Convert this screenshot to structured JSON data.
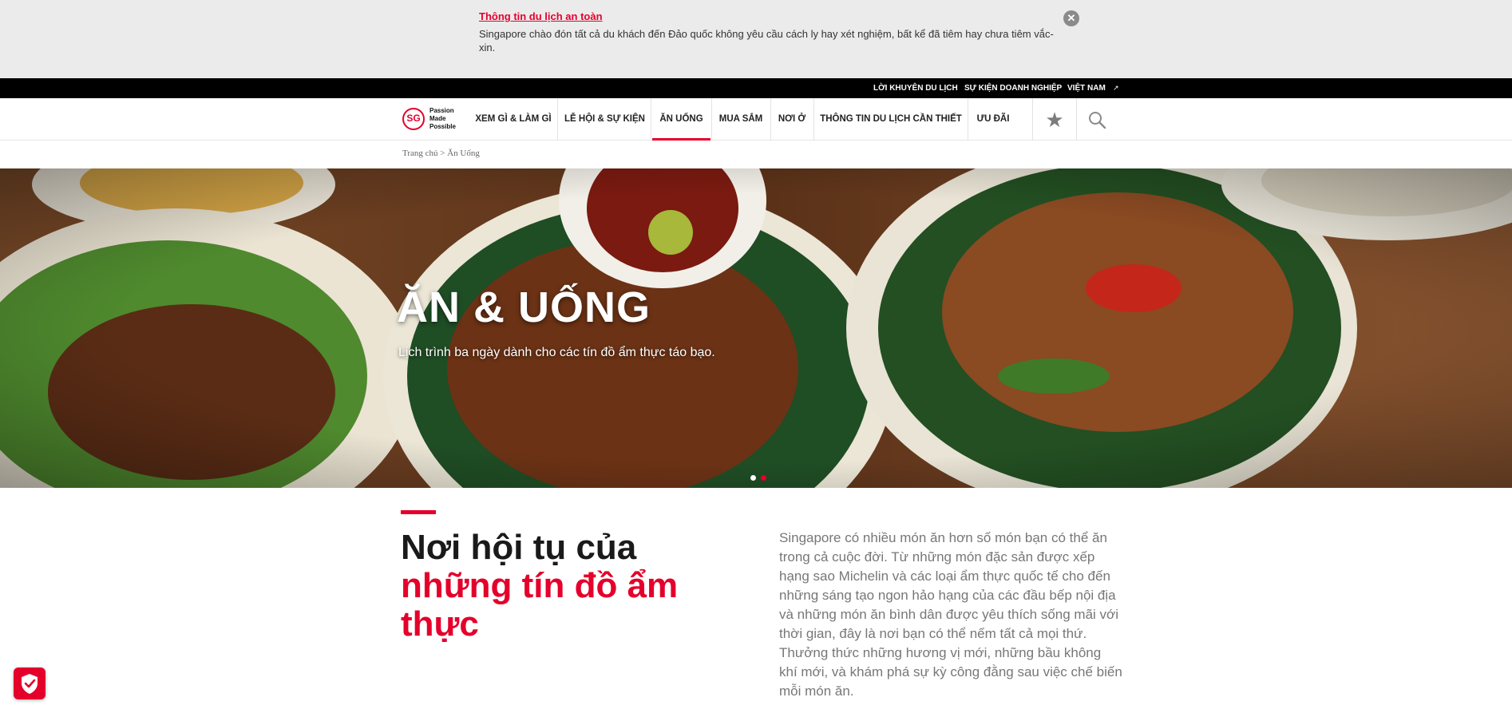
{
  "alert": {
    "title": "Thông tin du lịch an toàn",
    "text": "Singapore chào đón tất cả du khách đến Đảo quốc không yêu cầu cách ly hay xét nghiệm, bất kể đã tiêm hay chưa tiêm vắc-xin.",
    "close_icon": "close-icon"
  },
  "utility_bar": {
    "items": [
      "LỜI KHUYÊN DU LỊCH",
      "SỰ KIỆN DOANH NGHIỆP",
      "VIỆT NAM"
    ],
    "arrow_icon": "external-arrow-icon"
  },
  "nav": {
    "logo_mark": "SG",
    "logo_text": "Passion\nMade\nPossible",
    "items": [
      "XEM GÌ & LÀM GÌ",
      "LỄ HỘI & SỰ KIỆN",
      "ĂN UỐNG",
      "MUA SẮM",
      "NƠI Ở",
      "THÔNG TIN DU LỊCH CẦN THIẾT",
      "ƯU ĐÃI"
    ],
    "active_index": 2,
    "favorites_icon": "star-icon",
    "search_icon": "search-icon"
  },
  "breadcrumb": {
    "home": "Trang chủ",
    "separator": " > ",
    "current": "Ăn Uống"
  },
  "hero": {
    "title": "ĂN & UỐNG",
    "subtitle": "Lịch trình ba ngày dành cho các tín đồ ẩm thực táo bạo.",
    "slide_count": 2,
    "active_slide": 1
  },
  "intro": {
    "heading_line1": "Nơi hội tụ của",
    "heading_line2": "những tín đồ ẩm thực",
    "body": "Singapore có nhiều món ăn hơn số món bạn có thể ăn trong cả cuộc đời. Từ những món đặc sản được xếp hạng sao Michelin và các loại ẩm thực quốc tế cho đến những sáng tạo ngon hảo hạng của các đầu bếp nội địa và những món ăn bình dân được yêu thích sống mãi với thời gian, đây là nơi bạn có thể nếm tất cả mọi thứ. Thưởng thức những hương vị mới, những bầu không khí mới, và khám phá sự kỳ công đằng sau việc chế biến mỗi món ăn."
  },
  "privacy_badge": {
    "icon": "shield-check-icon"
  },
  "colors": {
    "accent": "#e4002b",
    "alert_bg": "#ebebeb",
    "utility_bg": "#000000",
    "body_text": "#777777"
  }
}
